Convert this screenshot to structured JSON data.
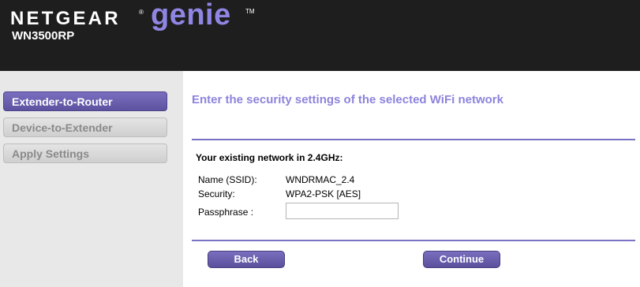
{
  "header": {
    "brand_netgear": "NETGEAR",
    "brand_reg": "®",
    "brand_genie": "genie",
    "brand_tm": "TM",
    "model": "WN3500RP"
  },
  "sidebar": {
    "items": [
      {
        "label": "Extender-to-Router",
        "active": true
      },
      {
        "label": "Device-to-Extender",
        "active": false
      },
      {
        "label": "Apply Settings",
        "active": false
      }
    ]
  },
  "main": {
    "title": "Enter the security settings of the selected WiFi network",
    "section_heading": "Your existing network in 2.4GHz:",
    "fields": {
      "ssid_label": "Name (SSID):",
      "ssid_value": "WNDRMAC_2.4",
      "security_label": "Security:",
      "security_value": "WPA2-PSK [AES]",
      "passphrase_label": "Passphrase :",
      "passphrase_value": ""
    },
    "buttons": {
      "back": "Back",
      "continue": "Continue"
    }
  },
  "colors": {
    "header_bg": "#1e1e1e",
    "genie_accent": "#8f86e3",
    "title_color": "#8c84dc",
    "button_bg": "#6a5fb0",
    "sidebar_bg": "#e8e8e8"
  }
}
